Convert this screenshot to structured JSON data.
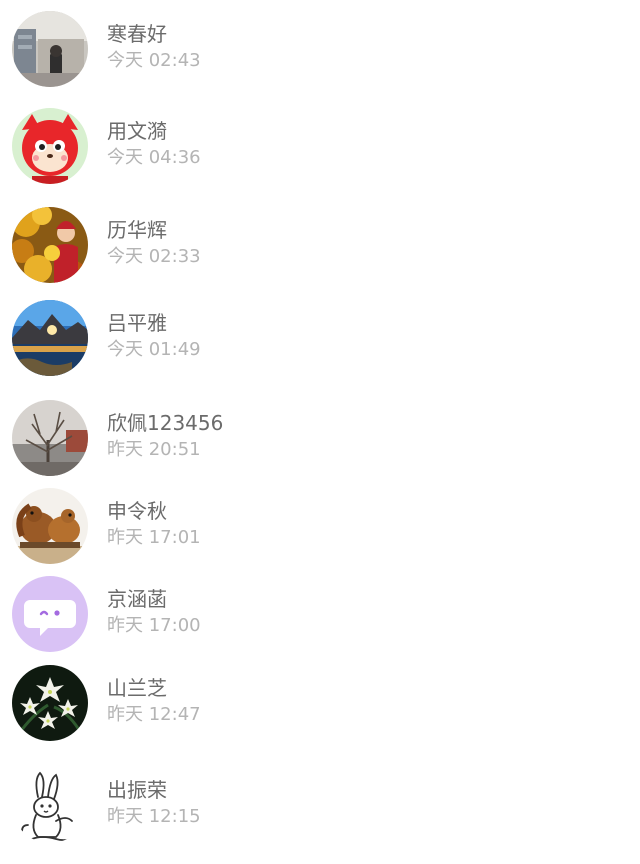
{
  "contacts": [
    {
      "name": "寒春好",
      "time": "今天 02:43",
      "avatar_icon": "person-by-window-photo"
    },
    {
      "name": "用文漪",
      "time": "今天 04:36",
      "avatar_icon": "red-fox-cartoon"
    },
    {
      "name": "历华辉",
      "time": "今天 02:33",
      "avatar_icon": "autumn-portrait-photo"
    },
    {
      "name": "吕平雅",
      "time": "今天 01:49",
      "avatar_icon": "mountain-lake-sunset-photo"
    },
    {
      "name": "欣佩123456",
      "time": "昨天 20:51",
      "avatar_icon": "bare-tree-photo"
    },
    {
      "name": "申令秋",
      "time": "昨天 17:01",
      "avatar_icon": "squirrels-photo"
    },
    {
      "name": "京涵菡",
      "time": "昨天 17:00",
      "avatar_icon": "chat-bubble-icon"
    },
    {
      "name": "山兰芝",
      "time": "昨天 12:47",
      "avatar_icon": "white-orchid-photo"
    },
    {
      "name": "出振荣",
      "time": "昨天 12:15",
      "avatar_icon": "rabbit-sketch"
    }
  ],
  "colors": {
    "name_text": "#6b6b6b",
    "time_text": "#b4b4b4",
    "background": "#ffffff",
    "chat_avatar_bg": "#d9c2f5"
  }
}
